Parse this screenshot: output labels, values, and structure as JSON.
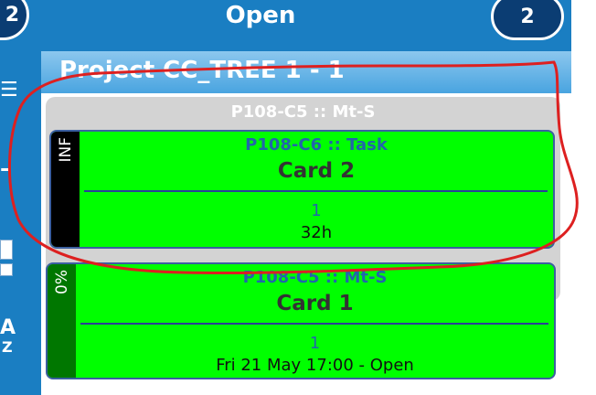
{
  "header": {
    "title": "Open",
    "count": "2",
    "left_badge": "2"
  },
  "left_strip": {
    "menu_glyph": "☰",
    "dash_glyph": "–",
    "sort_top": "A",
    "sort_bottom": "Z"
  },
  "project": {
    "title": "Project CC_TREE 1 - 1",
    "group": {
      "title": "P108-C5 :: Mt-S",
      "cards": [
        {
          "side_label": "INF",
          "subtitle": "P108-C6 :: Task",
          "name": "Card 2",
          "count": "1",
          "meta": "32h"
        }
      ]
    },
    "cards": [
      {
        "side_label": "0%",
        "subtitle": "P108-C5 :: Mt-S",
        "name": "Card 1",
        "count": "1",
        "meta": "Fri 21 May 17:00 - Open"
      }
    ]
  },
  "colors": {
    "header_blue": "#1a7ec2",
    "badge_navy": "#0b3d73",
    "card_green": "#00ff00",
    "side_black": "#000000",
    "side_dark_green": "#007700",
    "annotation_red": "#dd2020"
  }
}
